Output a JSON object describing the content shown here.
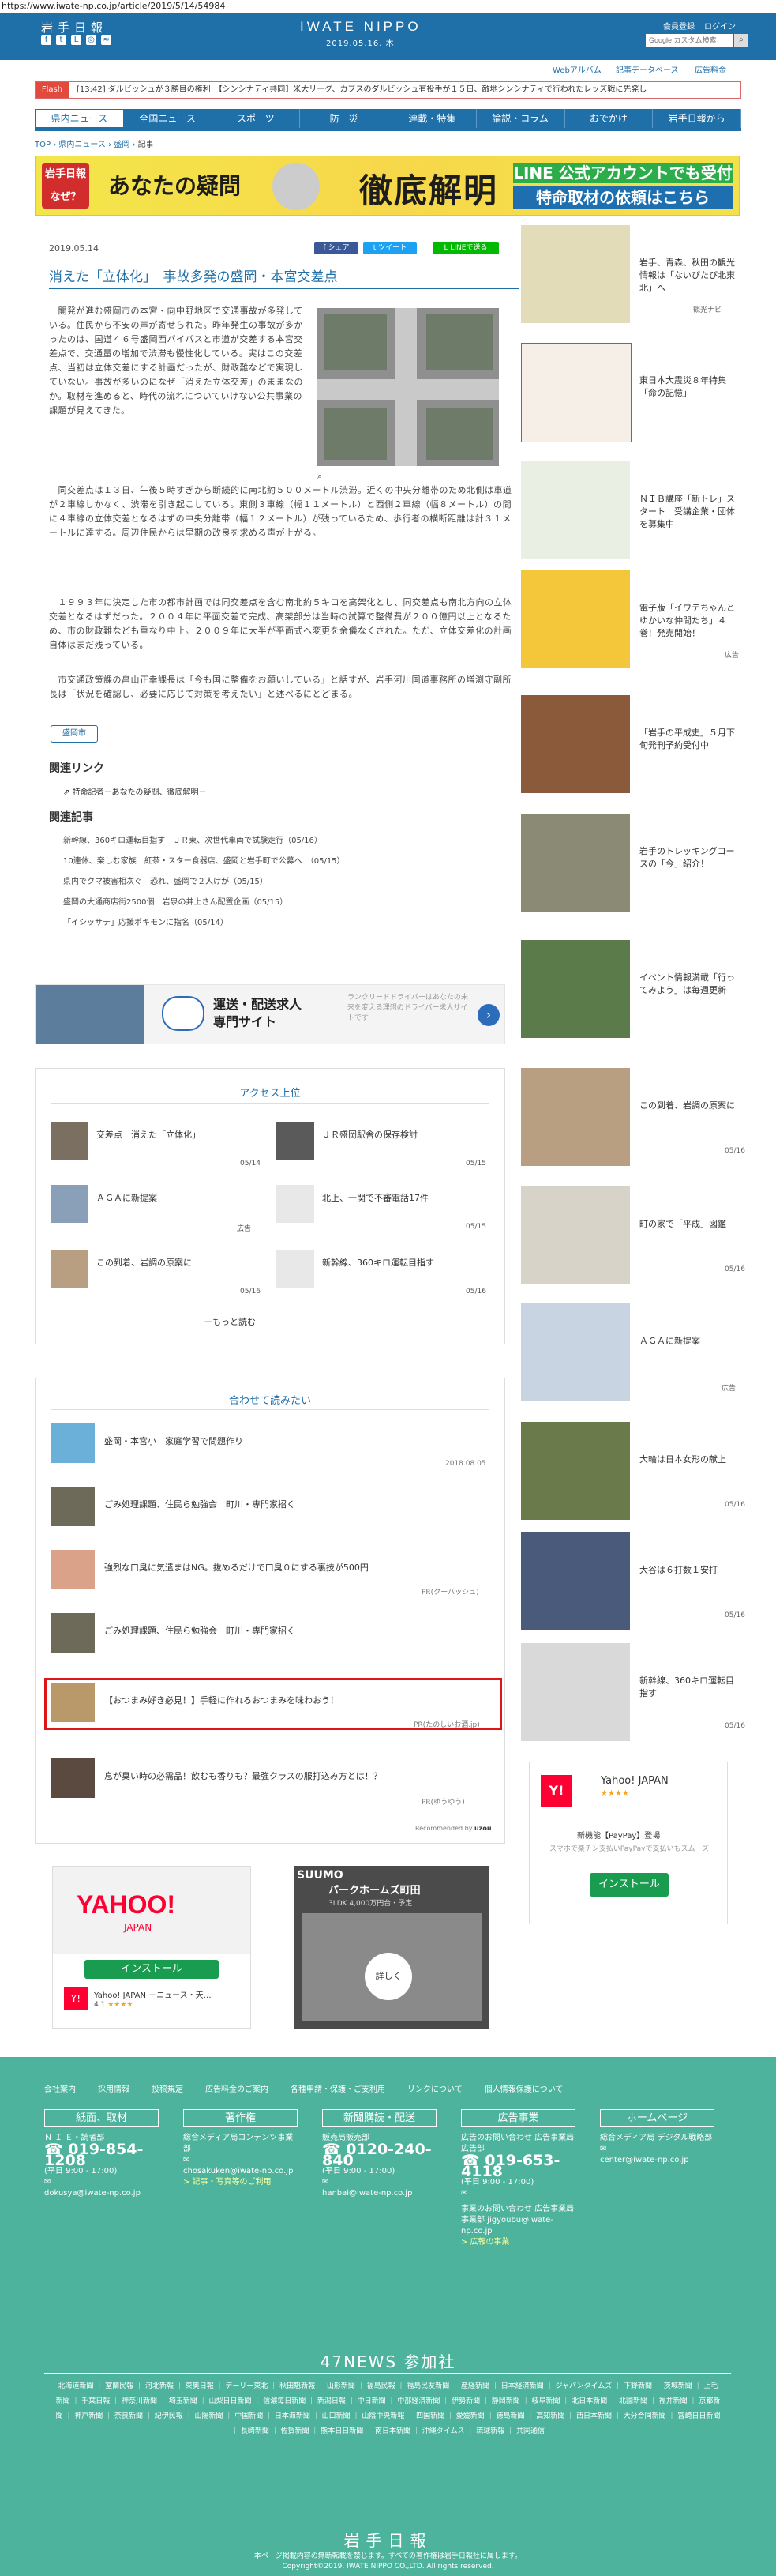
{
  "url": "https://www.iwate-np.co.jp/article/2019/5/14/54984",
  "header": {
    "logo_ja": "岩手日報",
    "logo_en": "IWATE NIPPO",
    "date": "2019.05.16. 木",
    "member_register": "会員登録",
    "login": "ログイン",
    "search_placeholder": "Google カスタム検索",
    "sub_links": [
      "Webアルバム",
      "記事データベース",
      "広告料金"
    ]
  },
  "flash": {
    "label": "Flash",
    "text": "[13:42] ダルビッシュが３勝目の権利　【シンシナティ共同】米大リーグ、カブスのダルビッシュ有投手が１５日、敵地シンシナティで行われたレッズ戦に先発し"
  },
  "nav": [
    "県内ニュース",
    "全国ニュース",
    "スポーツ",
    "防　災",
    "連載・特集",
    "論説・コラム",
    "おでかけ",
    "岩手日報から"
  ],
  "breadcrumb": {
    "top": "TOP",
    "sep": "›",
    "news": "県内ニュース",
    "region": "盛岡",
    "current": "記事"
  },
  "banner": {
    "left": "岩手日報 なぜ？",
    "title1": "あなたの疑問",
    "title2": "徹底解明",
    "line1": "LINE 公式アカウントでも受付",
    "line2": "特命取材の依頼はこちら"
  },
  "article": {
    "date": "2019.05.14",
    "share_fb": "シェア",
    "share_tw": "ツイート",
    "share_line": "LINEで送る",
    "title": "消えた「立体化」　事故多発の盛岡・本宮交差点",
    "p1": "　開発が進む盛岡市の本宮・向中野地区で交通事故が多発している。住民から不安の声が寄せられた。昨年発生の事故が多かったのは、国道４６号盛岡西バイパスと市道が交差する本宮交差点で、交通量の増加で渋滞も慢性化している。実はこの交差点、当初は立体交差にする計画だったが、財政難などで実現していない。事故が多いのになぜ「消えた立体交差」のままなのか。取材を進めると、時代の流れについていけない公共事業の課題が見えてきた。",
    "p2": "　同交差点は１３日、午後５時すぎから断続的に南北約５００メートル渋滞。近くの中央分離帯のため北側は車道が２車線しかなく、渋滞を引き起こしている。東側３車線（幅１１メートル）と西側２車線（幅８メートル）の間に４車線の立体交差となるはずの中央分離帯（幅１２メートル）が残っているため、歩行者の横断距離は計３１メートルに達する。周辺住民からは早期の改良を求める声が上がる。",
    "p3": "　１９９３年に決定した市の都市計画では同交差点を含む南北約５キロを高架化とし、同交差点も南北方向の立体交差となるはずだった。２００４年に平面交差で完成、高架部分は当時の試算で整備費が２００億円以上となるため、市の財政難なども重なり中止。２００９年に大半が平面式へ変更を余儀なくされた。ただ、立体交差化の計画自体はまだ残っている。",
    "p4": "　市交通政策課の畠山正幸課長は「今も国に整備をお願いしている」と話すが、岩手河川国道事務所の増渕守副所長は「状況を確認し、必要に応じて対策を考えたい」と述べるにとどまる。",
    "tag": "盛岡市",
    "related_link_heading": "関連リンク",
    "related_link": "特命記者－あなたの疑問、徹底解明－",
    "related_articles_heading": "関連記事",
    "related_articles": [
      "新幹線、360キロ運転目指す　ＪＲ東、次世代車両で試験走行（05/16）",
      "10連休、楽しむ家族　紅茶・スター食器店、盛岡と岩手町で公募へ　（05/15）",
      "県内でクマ被害相次ぐ　恐れ、盛岡で２人けが（05/15）",
      "盛岡の大通商店街2500個　岩泉の井上さん配置企画（05/15）",
      "「イシッサテ」応援ポキモンに指名（05/14）"
    ]
  },
  "ad_strip": {
    "title1": "運送・配送求人",
    "title2": "専門サイト",
    "desc": "ランクリードドライバーはあなたの未来を変える理想のドライバー求人サイトです",
    "arrow": "›"
  },
  "ranking": {
    "heading": "アクセス上位",
    "items": [
      {
        "text": "交差点　消えた「立体化」",
        "date": "05/14"
      },
      {
        "text": "ＪＲ盛岡駅舎の保存検討",
        "date": "05/15"
      },
      {
        "text": "ＡＧＡに新提案",
        "date": "広告"
      },
      {
        "text": "北上、一関で不審電話17件",
        "date": "05/15"
      },
      {
        "text": "この到着、岩調の原案に",
        "date": "05/16"
      },
      {
        "text": "新幹線、360キロ運転目指す",
        "date": "05/16"
      }
    ],
    "more": "＋もっと読む"
  },
  "together": {
    "heading": "合わせて読みたい",
    "items": [
      {
        "text": "盛岡・本宮小　家庭学習で問題作り",
        "src": "2018.08.05"
      },
      {
        "text": "ごみ処理課題、住民ら勉強会　町川・専門家招く",
        "src": ""
      },
      {
        "text": "強烈な口臭に気遣まはNG。抜めるだけで口臭０にする裏技が500円",
        "src": "PR(クーバッシュ)"
      },
      {
        "text": "ごみ処理課題、住民ら勉強会　町川・専門家招く",
        "src": ""
      },
      {
        "text": "【おつまみ好き必見！】手軽に作れるおつまみを味わおう！",
        "src": "PR(たのしいお酒.jp)"
      },
      {
        "text": "息が臭い時の必需品！飲むも香りも？最強クラスの服打込み方とは！？",
        "src": "PR(ゆうゆう)"
      }
    ],
    "recommend": "Recommended by"
  },
  "bottom_ads": {
    "yahoo_label": "YAHOO!",
    "yahoo_sub": "JAPAN",
    "install": "インストール",
    "yahoo_app": "Yahoo! JAPAN －ニュース・天…",
    "rating": "4.1",
    "suumo": "SUUMO",
    "suumo_title": "パークホームズ町田",
    "suumo_price": "3LDK 4,000万円台・予定",
    "suumo_btn": "詳しく"
  },
  "sidebar": [
    {
      "text": "岩手、青森、秋田の観光情報は「ないびたび北東北」へ",
      "src": "観光ナビ"
    },
    {
      "text": "東日本大震災８年特集「命の記憶」",
      "src": ""
    },
    {
      "text": "ＮＩＢ講座「新トレ」スタート　受講企業・団体を募集中",
      "src": ""
    },
    {
      "text": "電子版「イワテちゃんとゆかいな仲間たち」４巻！発売開始！",
      "src": "広告"
    },
    {
      "text": "「岩手の平成史」５月下旬発刊予約受付中",
      "src": ""
    },
    {
      "text": "岩手のトレッキングコースの「今」紹介！",
      "src": ""
    },
    {
      "text": "イベント情報満載「行ってみよう」は毎週更新",
      "src": ""
    },
    {
      "text": "この到着、岩調の原案に",
      "src": "05/16"
    },
    {
      "text": "町の家で「平成」図鑑",
      "src": "05/16"
    },
    {
      "text": "ＡＧＡに新提案",
      "src": "広告"
    },
    {
      "text": "大輪は日本女形の献上",
      "src": "05/16"
    },
    {
      "text": "大谷は６打数１安打",
      "src": "05/16"
    },
    {
      "text": "新幹線、360キロ運転目指す",
      "src": "05/16"
    }
  ],
  "sidebar_yahoo": {
    "title": "Yahoo! JAPAN",
    "sub": "新機能【PayPay】登場",
    "desc": "スマホで楽チン支払いPayPayで支払いもスムーズ",
    "install": "インストール"
  },
  "footer": {
    "links": [
      "会社案内",
      "採用情報",
      "投稿規定",
      "広告料金のご案内",
      "各種申請・保護・ご支利用",
      "リンクについて",
      "個人情報保護について"
    ],
    "cols": [
      {
        "h": "紙面、取材",
        "b1": "Ｎ Ｉ Ｅ・読者部",
        "tel": "019-854-1208",
        "hours": "(平日 9:00 - 17:00)",
        "mail": "dokusya@iwate-np.co.jp"
      },
      {
        "h": "著作権",
        "b1": "総合メディア局コンテンツ事業部",
        "tel": "",
        "hours": "",
        "mail": "chosakuken@iwate-np.co.jp",
        "extra": "> 記事・写真等のご利用"
      },
      {
        "h": "新聞購読・配送",
        "b1": "販売局販売部",
        "tel": "0120-240-840",
        "hours": "(平日 9:00 - 17:00)",
        "mail": "hanbai@iwate-np.co.jp"
      },
      {
        "h": "広告事業",
        "b1": "広告のお問い合わせ 広告事業局広告部",
        "tel": "019-653-4118",
        "hours": "(平日 9:00 - 17:00)",
        "mail": "",
        "extra": "事業のお問い合わせ 広告事業局事業部 jigyoubu@iwate-np.co.jp",
        "extra2": "> 広報の事業"
      },
      {
        "h": "ホームページ",
        "b1": "総合メディア局 デジタル戦略部",
        "tel": "",
        "hours": "",
        "mail": "center@iwate-np.co.jp"
      }
    ],
    "news47": "47NEWS 参加社",
    "news47_list": "北海道新聞 ｜ 室蘭民報 ｜ 河北新報 ｜ 東奥日報 ｜ デーリー東北 ｜ 秋田魁新報 ｜ 山形新聞 ｜ 福島民報 ｜ 福島民友新聞 ｜ 産経新聞 ｜ 日本経済新聞 ｜ ジャパンタイムズ ｜ 下野新聞 ｜ 茨城新聞 ｜ 上毛新聞 ｜ 千葉日報 ｜ 神奈川新聞 ｜ 埼玉新聞 ｜ 山梨日日新聞 ｜ 信濃毎日新聞 ｜ 新潟日報 ｜ 中日新聞 ｜ 中部経済新聞 ｜ 伊勢新聞 ｜ 静岡新聞 ｜ 岐阜新聞 ｜ 北日本新聞 ｜ 北國新聞 ｜ 福井新聞 ｜ 京都新聞 ｜ 神戸新聞 ｜ 奈良新聞 ｜ 紀伊民報 ｜ 山陽新聞 ｜ 中国新聞 ｜ 日本海新聞 ｜ 山口新聞 ｜ 山陰中央新報 ｜ 四国新聞 ｜ 愛媛新聞 ｜ 徳島新聞 ｜ 高知新聞 ｜ 西日本新聞 ｜ 大分合同新聞 ｜ 宮崎日日新聞 ｜ 長崎新聞 ｜ 佐賀新聞 ｜ 熊本日日新聞 ｜ 南日本新聞 ｜ 沖縄タイムス ｜ 琉球新報 ｜ 共同通信",
    "logo": "岩手日報",
    "copy1": "本ページ掲載内容の無断転載を禁じます。すべての著作権は岩手日報社に属します。",
    "copy2": "Copyright©2019, IWATE NIPPO CO.,LTD. All rights reserved."
  }
}
